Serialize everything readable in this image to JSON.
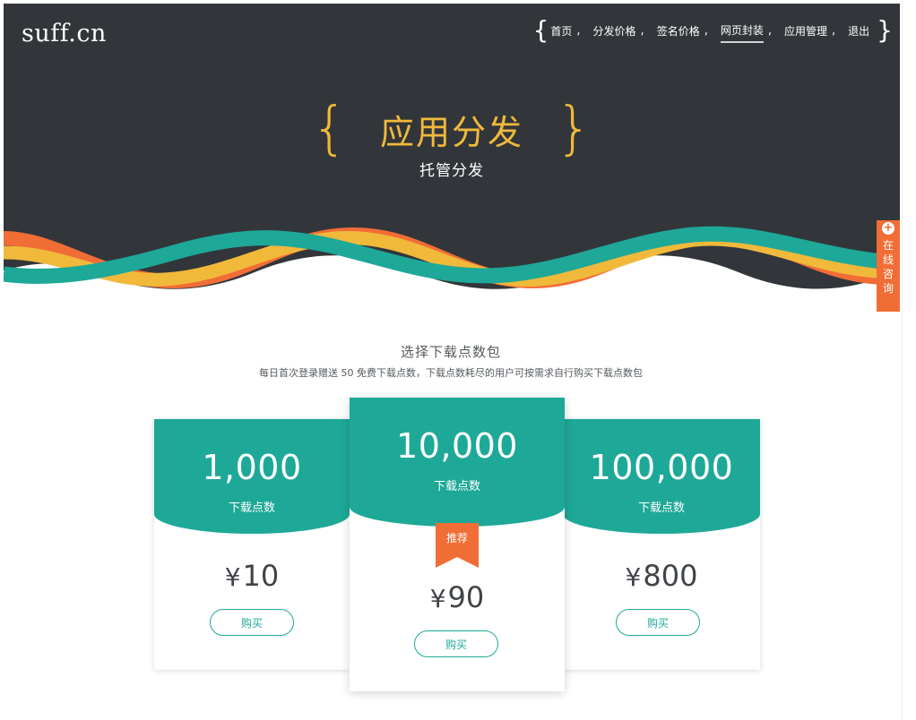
{
  "colors": {
    "dark_bg": "#32363a",
    "accent_teal": "#1ea898",
    "accent_orange": "#f16d36",
    "accent_yellow": "#f1b93a"
  },
  "header": {
    "logo": "suff.cn",
    "brace_open": "{",
    "brace_close": "}",
    "separator": ",",
    "nav": [
      {
        "label": "首页"
      },
      {
        "label": "分发价格"
      },
      {
        "label": "签名价格"
      },
      {
        "label": "网页封装"
      },
      {
        "label": "应用管理"
      },
      {
        "label": "退出"
      }
    ],
    "active_index": 3
  },
  "hero": {
    "brace_open": "{",
    "brace_close": "}",
    "title": "应用分发",
    "subtitle": "托管分发"
  },
  "consult": {
    "icon": "plus-circle-icon",
    "label": "在线咨询"
  },
  "section": {
    "title": "选择下载点数包",
    "description": "每日首次登录赠送 50 免费下载点数，下载点数耗尽的用户可按需求自行购买下载点数包"
  },
  "plans": [
    {
      "points": "1,000",
      "unit": "下载点数",
      "currency": "¥",
      "price": "10",
      "button": "购买"
    },
    {
      "points": "10,000",
      "unit": "下载点数",
      "currency": "¥",
      "price": "90",
      "button": "购买",
      "badge": "推荐"
    },
    {
      "points": "100,000",
      "unit": "下载点数",
      "currency": "¥",
      "price": "800",
      "button": "购买"
    }
  ]
}
